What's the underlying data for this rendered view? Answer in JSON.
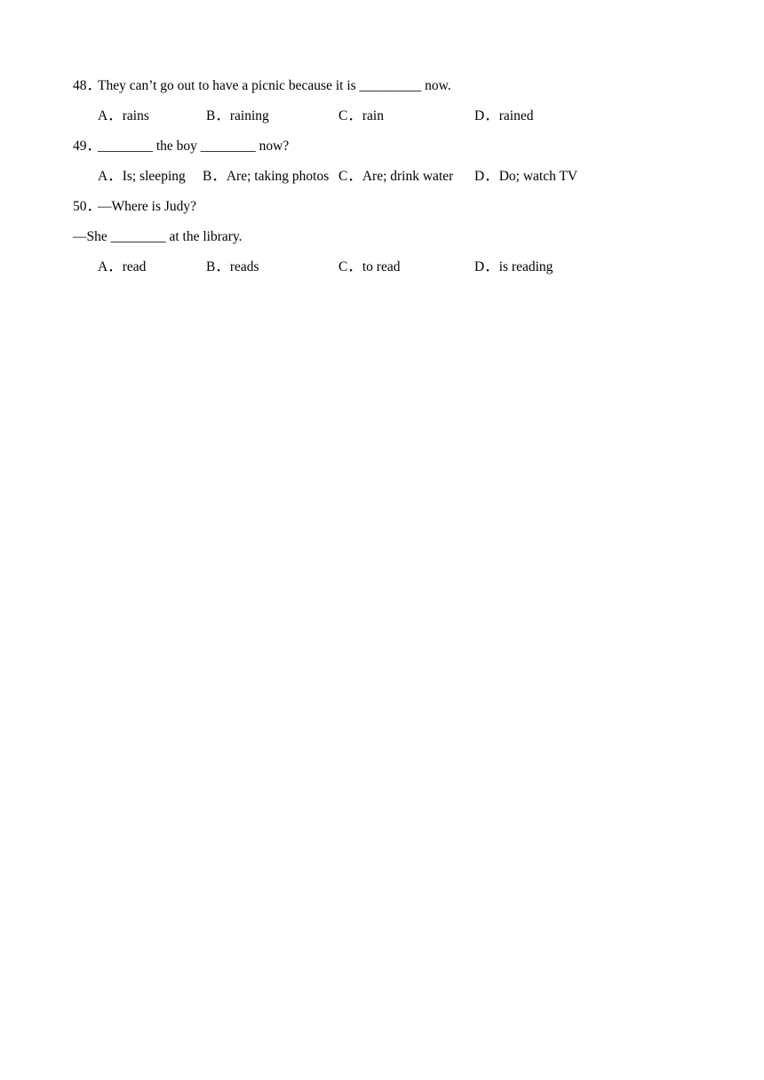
{
  "document": {
    "type": "worksheet",
    "background_color": "#ffffff",
    "text_color": "#000000"
  },
  "questions": [
    {
      "number": "48．",
      "lines": [
        {
          "text": "They can’t go out to have a picnic because it is _________ now.",
          "flush": false
        }
      ],
      "options": [
        {
          "letter": "A",
          "sep": "．",
          "text": "rains"
        },
        {
          "letter": "B",
          "sep": "．",
          "text": "raining"
        },
        {
          "letter": "C",
          "sep": "．",
          "text": "rain"
        },
        {
          "letter": "D",
          "sep": "．",
          "text": "rained"
        }
      ],
      "column_preset": "wide"
    },
    {
      "number": "49．",
      "lines": [
        {
          "text": "________ the boy ________ now?",
          "flush": false
        }
      ],
      "options": [
        {
          "letter": "A",
          "sep": "．",
          "text": "Is; sleeping"
        },
        {
          "letter": "B",
          "sep": "．",
          "text": "Are; taking photos"
        },
        {
          "letter": "C",
          "sep": "．",
          "text": "Are; drink water"
        },
        {
          "letter": "D",
          "sep": "．",
          "text": "Do; watch TV"
        }
      ],
      "column_preset": "narrow"
    },
    {
      "number": "50．",
      "lines": [
        {
          "text": "—Where is Judy?",
          "flush": false
        },
        {
          "text": "—She ________ at the library.",
          "flush": true
        }
      ],
      "options": [
        {
          "letter": "A",
          "sep": "．",
          "text": "read"
        },
        {
          "letter": "B",
          "sep": "．",
          "text": "reads"
        },
        {
          "letter": "C",
          "sep": "．",
          "text": "to read"
        },
        {
          "letter": "D",
          "sep": "．",
          "text": "is reading"
        }
      ],
      "column_preset": "wide"
    }
  ]
}
